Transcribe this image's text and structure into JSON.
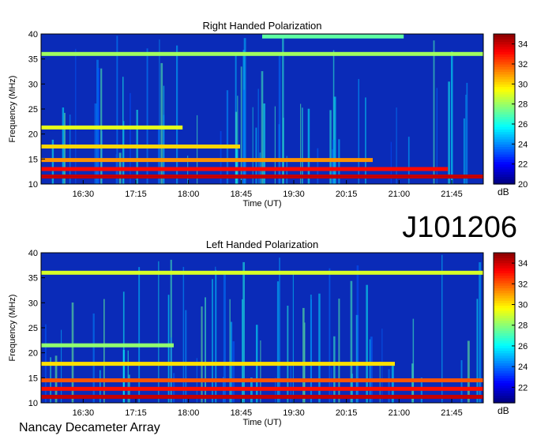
{
  "chart_data": [
    {
      "type": "heatmap",
      "title": "Right Handed Polarization",
      "xlabel": "Time (UT)",
      "ylabel": "Frequency (MHz)",
      "x_ticks": [
        "16:30",
        "17:15",
        "18:00",
        "18:45",
        "19:30",
        "20:15",
        "21:00",
        "21:45"
      ],
      "y_ticks": [
        10,
        15,
        20,
        25,
        30,
        35,
        40
      ],
      "ylim": [
        10,
        40
      ],
      "colorbar": {
        "label": "dB",
        "ticks": [
          20,
          22,
          24,
          26,
          28,
          30,
          32,
          34
        ],
        "range": [
          20,
          35
        ]
      },
      "features": [
        {
          "kind": "band",
          "freq": 11.5,
          "level": 34,
          "t0": 0.0,
          "t1": 1.0
        },
        {
          "kind": "band",
          "freq": 13.0,
          "level": 33,
          "t0": 0.0,
          "t1": 0.92
        },
        {
          "kind": "band",
          "freq": 14.8,
          "level": 31,
          "t0": 0.0,
          "t1": 0.75
        },
        {
          "kind": "band",
          "freq": 17.5,
          "level": 30,
          "t0": 0.0,
          "t1": 0.45
        },
        {
          "kind": "band",
          "freq": 21.3,
          "level": 29,
          "t0": 0.0,
          "t1": 0.32
        },
        {
          "kind": "band",
          "freq": 36.0,
          "level": 28,
          "t0": 0.0,
          "t1": 1.0
        },
        {
          "kind": "band",
          "freq": 39.5,
          "level": 27,
          "t0": 0.5,
          "t1": 0.82
        }
      ]
    },
    {
      "type": "heatmap",
      "title": "Left Handed Polarization",
      "xlabel": "Time (UT)",
      "ylabel": "Frequency (MHz)",
      "x_ticks": [
        "16:30",
        "17:15",
        "18:00",
        "18:45",
        "19:30",
        "20:15",
        "21:00",
        "21:45"
      ],
      "y_ticks": [
        10,
        15,
        20,
        25,
        30,
        35,
        40
      ],
      "ylim": [
        10,
        40
      ],
      "colorbar": {
        "label": "dB",
        "ticks": [
          22,
          24,
          26,
          28,
          30,
          32,
          34
        ],
        "range": [
          20.5,
          35
        ]
      },
      "features": [
        {
          "kind": "band",
          "freq": 11.2,
          "level": 34,
          "t0": 0.0,
          "t1": 1.0
        },
        {
          "kind": "band",
          "freq": 12.8,
          "level": 33,
          "t0": 0.0,
          "t1": 1.0
        },
        {
          "kind": "band",
          "freq": 14.5,
          "level": 32,
          "t0": 0.0,
          "t1": 1.0
        },
        {
          "kind": "band",
          "freq": 17.8,
          "level": 30,
          "t0": 0.0,
          "t1": 0.8
        },
        {
          "kind": "band",
          "freq": 21.5,
          "level": 28,
          "t0": 0.0,
          "t1": 0.3
        },
        {
          "kind": "band",
          "freq": 36.0,
          "level": 29,
          "t0": 0.0,
          "t1": 1.0
        }
      ]
    }
  ],
  "observation_id": "J101206",
  "instrument": "Nancay Decameter Array"
}
